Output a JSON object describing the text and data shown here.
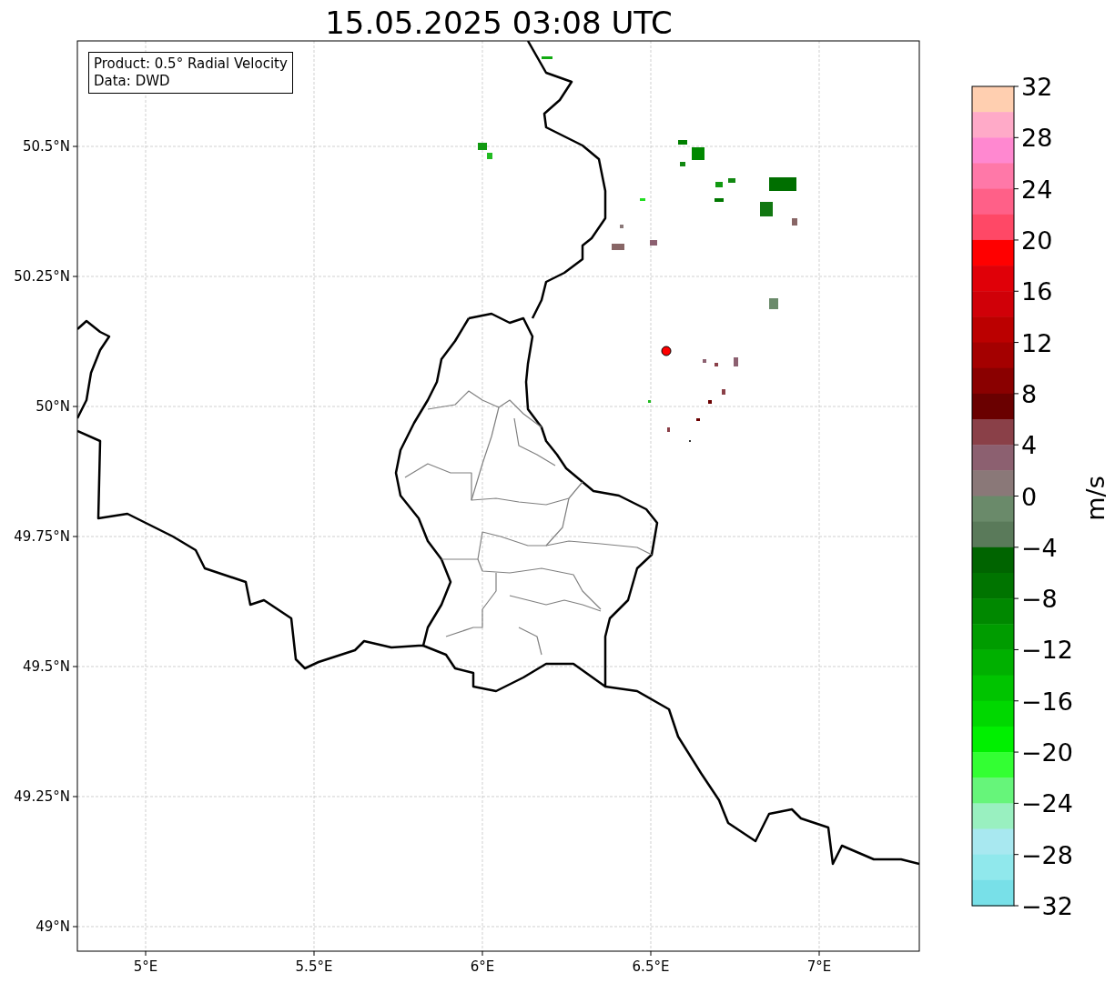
{
  "title": "15.05.2025 03:08 UTC",
  "info_box": [
    "Product: 0.5° Radial Velocity",
    "Data: DWD"
  ],
  "map": {
    "lat_labels": [
      "50.5°N",
      "50.25°N",
      "50°N",
      "49.75°N",
      "49.5°N",
      "49.25°N",
      "49°N"
    ],
    "lon_labels": [
      "5°E",
      "5.5°E",
      "6°E",
      "6.5°E",
      "7°E"
    ]
  },
  "colorbar": {
    "label": "m/s",
    "tick_labels": [
      "32",
      "28",
      "24",
      "20",
      "16",
      "12",
      "8",
      "4",
      "0",
      "−4",
      "−8",
      "−12",
      "−16",
      "−20",
      "−24",
      "−28",
      "−32"
    ],
    "segments": [
      {
        "color": "#ffcfb0"
      },
      {
        "color": "#ffaac8"
      },
      {
        "color": "#ff88d0"
      },
      {
        "color": "#ff78a8"
      },
      {
        "color": "#ff6088"
      },
      {
        "color": "#ff4866"
      },
      {
        "color": "#ff0000"
      },
      {
        "color": "#e00008"
      },
      {
        "color": "#d00008"
      },
      {
        "color": "#bb0000"
      },
      {
        "color": "#a40000"
      },
      {
        "color": "#8a0000"
      },
      {
        "color": "#6a0000"
      },
      {
        "color": "#8a4048"
      },
      {
        "color": "#8c6070"
      },
      {
        "color": "#8a7878"
      },
      {
        "color": "#6a8a6a"
      },
      {
        "color": "#5a7a5a"
      },
      {
        "color": "#006400"
      },
      {
        "color": "#007400"
      },
      {
        "color": "#008800"
      },
      {
        "color": "#009c00"
      },
      {
        "color": "#00b000"
      },
      {
        "color": "#00c400"
      },
      {
        "color": "#00d800"
      },
      {
        "color": "#00f000"
      },
      {
        "color": "#33ff33"
      },
      {
        "color": "#66f57a"
      },
      {
        "color": "#99f0c0"
      },
      {
        "color": "#a8e8f0"
      },
      {
        "color": "#90e8ec"
      },
      {
        "color": "#78e0e8"
      }
    ]
  }
}
